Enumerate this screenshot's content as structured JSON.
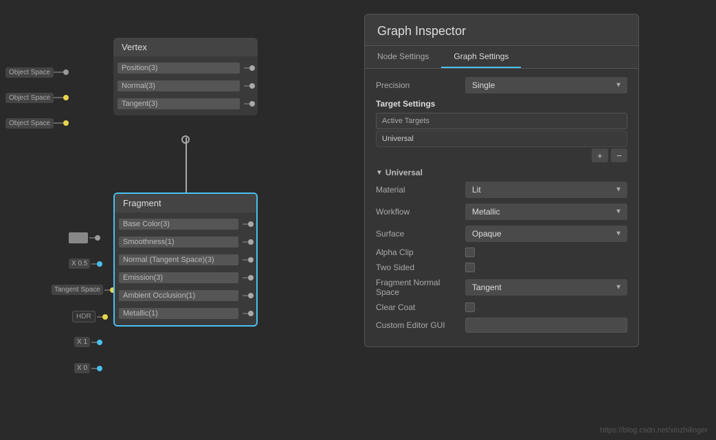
{
  "graph": {
    "vertex_node": {
      "title": "Vertex",
      "ports": [
        {
          "label": "Object Space",
          "name": "Position(3)",
          "dot_class": "dot-position"
        },
        {
          "label": "Object Space",
          "name": "Normal(3)",
          "dot_class": "dot-normal"
        },
        {
          "label": "Object Space",
          "name": "Tangent(3)",
          "dot_class": "dot-tangent"
        }
      ]
    },
    "fragment_node": {
      "title": "Fragment",
      "ports": [
        {
          "value": "",
          "value_type": "color",
          "name": "Base Color(3)",
          "dot_class": "dot-basecolor"
        },
        {
          "value": "X  0.5",
          "value_type": "number",
          "name": "Smoothness(1)",
          "dot_class": "dot-smoothness"
        },
        {
          "value": "Tangent Space",
          "value_type": "label",
          "name": "Normal (Tangent Space)(3)",
          "dot_class": "dot-normalts"
        },
        {
          "value": "HDR",
          "value_type": "hdr",
          "name": "Emission(3)",
          "dot_class": "dot-emission"
        },
        {
          "value": "X  1",
          "value_type": "number",
          "name": "Ambient Occlusion(1)",
          "dot_class": "dot-ao"
        },
        {
          "value": "X  0",
          "value_type": "number",
          "name": "Metallic(1)",
          "dot_class": "dot-metallic"
        }
      ]
    }
  },
  "inspector": {
    "title": "Graph Inspector",
    "tabs": [
      {
        "label": "Node Settings",
        "active": false
      },
      {
        "label": "Graph Settings",
        "active": true
      }
    ],
    "precision_label": "Precision",
    "precision_value": "Single",
    "target_settings_label": "Target Settings",
    "active_targets_label": "Active Targets",
    "universal_item": "Universal",
    "add_btn": "+",
    "remove_btn": "−",
    "universal_section": "Universal",
    "fields": [
      {
        "label": "Material",
        "type": "dropdown",
        "value": "Lit"
      },
      {
        "label": "Workflow",
        "type": "dropdown",
        "value": "Metallic"
      },
      {
        "label": "Surface",
        "type": "dropdown",
        "value": "Opaque"
      },
      {
        "label": "Alpha Clip",
        "type": "checkbox"
      },
      {
        "label": "Two Sided",
        "type": "checkbox"
      },
      {
        "label": "Fragment Normal Space",
        "type": "dropdown",
        "value": "Tangent"
      },
      {
        "label": "Clear Coat",
        "type": "checkbox"
      },
      {
        "label": "Custom Editor GUI",
        "type": "text",
        "value": ""
      }
    ]
  },
  "watermark": "https://blog.csdn.net/xinzhilinger"
}
